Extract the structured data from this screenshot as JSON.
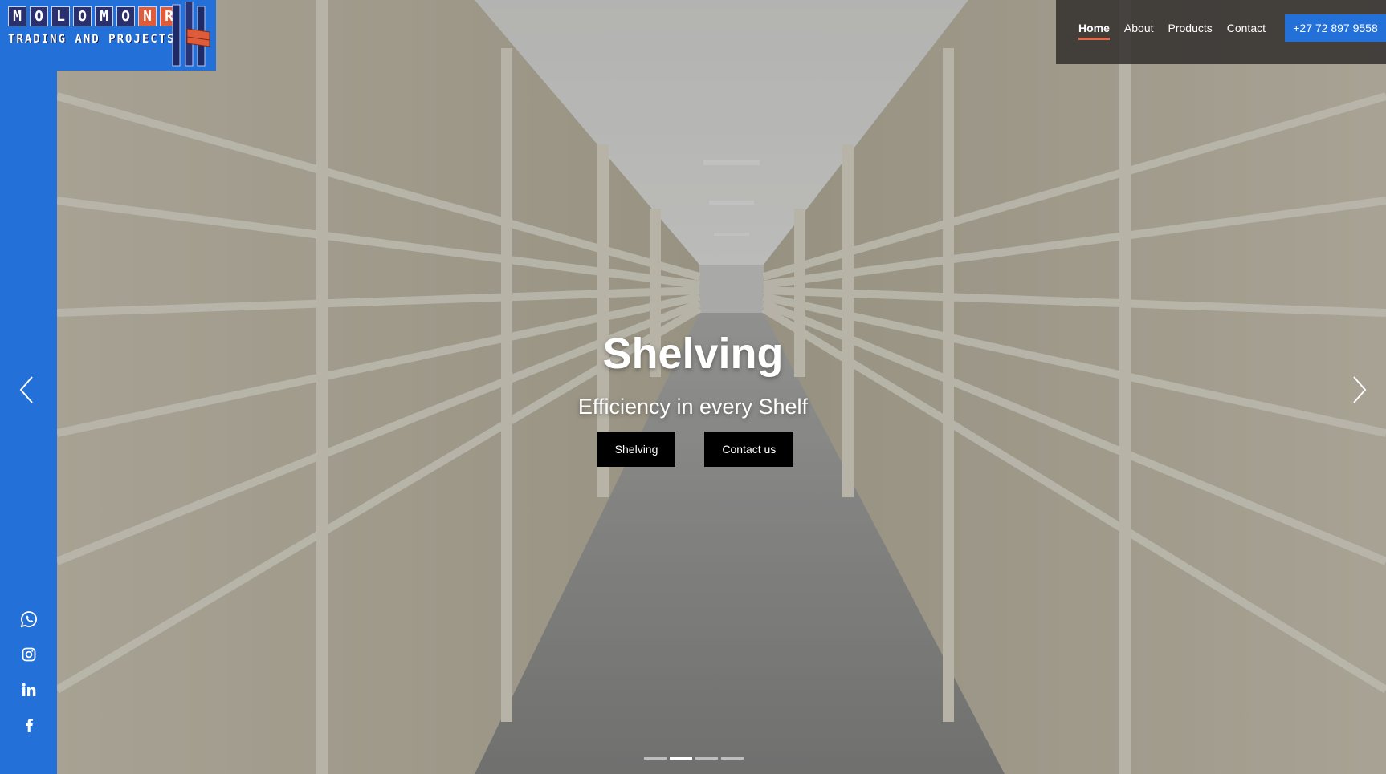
{
  "brand": {
    "letters": [
      "M",
      "O",
      "L",
      "O",
      "M",
      "O",
      "N",
      "R"
    ],
    "tagline": "TRADING AND PROJECTS",
    "colors": {
      "blue": "#2370d8",
      "accent": "#e05b3a",
      "dark": "#2a2f6e"
    }
  },
  "nav": {
    "items": [
      {
        "label": "Home",
        "active": true
      },
      {
        "label": "About",
        "active": false
      },
      {
        "label": "Products",
        "active": false
      },
      {
        "label": "Contact",
        "active": false
      }
    ],
    "phone": "+27 72 897 9558"
  },
  "hero": {
    "title": "Shelving",
    "subtitle": "Efficiency in every Shelf",
    "buttons": [
      {
        "label": "Shelving"
      },
      {
        "label": "Contact us"
      }
    ],
    "prev_icon": "chevron-left-icon",
    "next_icon": "chevron-right-icon"
  },
  "carousel": {
    "slide_count": 4,
    "active_index": 1
  },
  "social": [
    {
      "icon": "whatsapp-icon"
    },
    {
      "icon": "instagram-icon"
    },
    {
      "icon": "linkedin-icon"
    },
    {
      "icon": "facebook-icon"
    }
  ]
}
